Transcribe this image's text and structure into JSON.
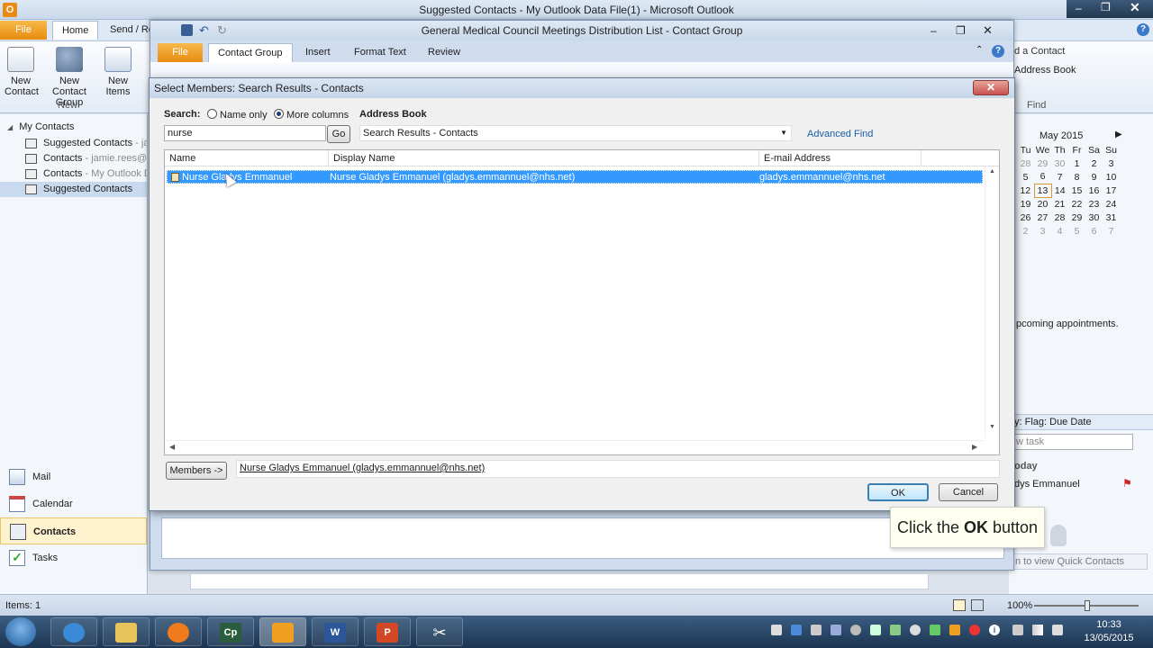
{
  "main": {
    "title": "Suggested Contacts - My Outlook Data File(1)  -  Microsoft Outlook",
    "tabs": [
      "File",
      "Home",
      "Send / Re"
    ],
    "ribbon": {
      "new_contact": "New Contact",
      "new_contact_group": "New Contact Group",
      "new_items": "New Items",
      "group_new": "New",
      "find_contact": "d a Contact",
      "address_book": "Address Book",
      "group_find": "Find"
    },
    "nav": {
      "section": "My Contacts",
      "folders": [
        {
          "name": "Suggested Contacts",
          "sub": " - ja"
        },
        {
          "name": "Contacts",
          "sub": " - jamie.rees@n"
        },
        {
          "name": "Contacts",
          "sub": " - My Outlook D"
        },
        {
          "name": "Suggested Contacts",
          "sub": ""
        }
      ],
      "modules": [
        "Mail",
        "Calendar",
        "Contacts",
        "Tasks"
      ]
    },
    "todo": {
      "month": "May 2015",
      "weekdays": [
        "Tu",
        "We",
        "Th",
        "Fr",
        "Sa",
        "Su"
      ],
      "weeks": [
        [
          "28",
          "29",
          "30",
          "1",
          "2",
          "3"
        ],
        [
          "5",
          "6",
          "7",
          "8",
          "9",
          "10"
        ],
        [
          "12",
          "13",
          "14",
          "15",
          "16",
          "17"
        ],
        [
          "19",
          "20",
          "21",
          "22",
          "23",
          "24"
        ],
        [
          "26",
          "27",
          "28",
          "29",
          "30",
          "31"
        ],
        [
          "2",
          "3",
          "4",
          "5",
          "6",
          "7"
        ]
      ],
      "appointments": "pcoming appointments.",
      "flag_header": "y: Flag: Due Date",
      "new_task": "w task",
      "today": "oday",
      "task_item": "dys Emmanuel",
      "quick_contacts": "n to view Quick Contacts"
    },
    "status": {
      "items": "Items: 1",
      "zoom": "100%"
    },
    "clock": {
      "time": "10:33",
      "date": "13/05/2015"
    }
  },
  "contact_group": {
    "title": "General Medical Council Meetings Distribution List  -  Contact Group",
    "tabs": [
      "File",
      "Contact Group",
      "Insert",
      "Format Text",
      "Review"
    ]
  },
  "dialog": {
    "title": "Select Members: Search Results - Contacts",
    "search_label": "Search:",
    "opt_name_only": "Name only",
    "opt_more_columns": "More columns",
    "address_book_label": "Address Book",
    "search_value": "nurse",
    "go": "Go",
    "address_book_value": "Search Results - Contacts",
    "advanced_find": "Advanced Find",
    "columns": [
      "Name",
      "Display Name",
      "E-mail Address"
    ],
    "rows": [
      {
        "name": "Nurse Gladys Emmanuel",
        "display": "Nurse Gladys Emmanuel (gladys.emmannuel@nhs.net)",
        "email": "gladys.emmannuel@nhs.net"
      }
    ],
    "members_button": "Members ->",
    "members_value": "Nurse Gladys Emmanuel (gladys.emmannuel@nhs.net)",
    "ok": "OK",
    "cancel": "Cancel"
  },
  "tooltip": {
    "prefix": "Click the ",
    "bold": "OK",
    "suffix": " button"
  },
  "colors": {
    "accent_file": "#e88b10",
    "selection": "#3399ff",
    "link": "#1a5ea8"
  }
}
